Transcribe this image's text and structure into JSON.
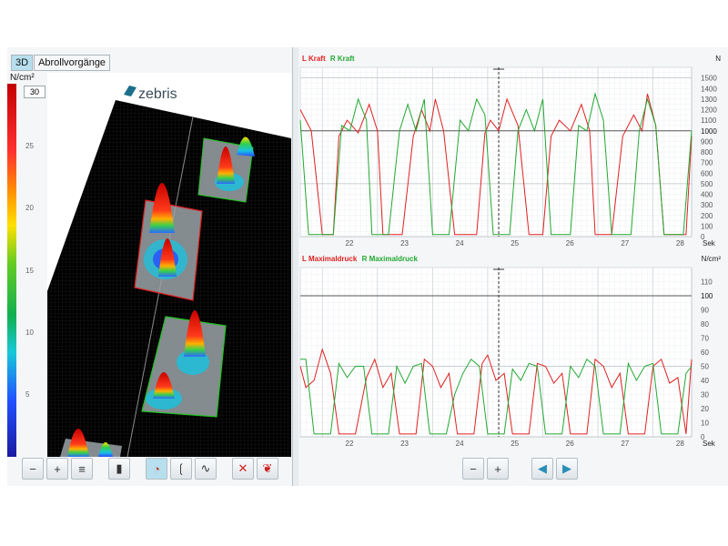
{
  "tabs": [
    {
      "label": "3D",
      "active": true
    },
    {
      "label": "Abrollvorgänge",
      "active": false
    }
  ],
  "pressure_scale": {
    "unit": "N/cm²",
    "box_value": "30",
    "ticks": [
      "25",
      "20",
      "15",
      "10",
      "5"
    ]
  },
  "scene": {
    "logo": "zebris"
  },
  "left_toolbar": {
    "icons": [
      "zoom-out-icon",
      "zoom-in-icon",
      "zoom-reset-icon",
      "view-mode-icon",
      "foot-view-icon",
      "left-foot-icon",
      "gait-line-icon",
      "clear-icon",
      "both-feet-icon"
    ]
  },
  "right_toolbar": {
    "icons": [
      "zoom-out-icon",
      "zoom-in-icon",
      "step-back-icon",
      "step-forward-icon"
    ]
  },
  "colors": {
    "left": "#e02020",
    "right": "#22a832",
    "background": "#f4f6f7"
  },
  "chart_data": [
    {
      "type": "line",
      "title": "",
      "legend": [
        {
          "label": "L Kraft",
          "color": "#e02020"
        },
        {
          "label": "R Kraft",
          "color": "#22a832"
        }
      ],
      "xlabel": "Sek",
      "ylabel": "N",
      "xlim": [
        21.1,
        28.2
      ],
      "ylim": [
        0,
        1600
      ],
      "xticks": [
        "22",
        "23",
        "24",
        "25",
        "26",
        "27",
        "28"
      ],
      "yticks": [
        "0",
        "100",
        "200",
        "300",
        "400",
        "500",
        "600",
        "700",
        "800",
        "900",
        "1000",
        "1100",
        "1200",
        "1300",
        "1400",
        "1500"
      ],
      "highlight_yticks": [
        "1000"
      ],
      "series": [
        {
          "name": "L Kraft",
          "x": [
            21.1,
            21.3,
            21.5,
            21.62,
            21.7,
            21.8,
            21.95,
            22.15,
            22.35,
            22.5,
            22.6,
            22.75,
            22.95,
            23.15,
            23.3,
            23.45,
            23.55,
            23.7,
            23.9,
            24.1,
            24.3,
            24.45,
            24.55,
            24.7,
            24.85,
            25.05,
            25.25,
            25.4,
            25.5,
            25.65,
            25.8,
            26.0,
            26.2,
            26.35,
            26.45,
            26.6,
            26.75,
            26.95,
            27.15,
            27.3,
            27.4,
            27.55,
            27.7,
            27.9,
            28.1,
            28.2
          ],
          "y": [
            1200,
            1000,
            20,
            20,
            20,
            950,
            1100,
            980,
            1250,
            1000,
            20,
            20,
            20,
            950,
            1200,
            1000,
            1300,
            1000,
            20,
            20,
            20,
            980,
            1100,
            1000,
            1300,
            1050,
            20,
            20,
            20,
            950,
            1100,
            1000,
            1250,
            1000,
            20,
            20,
            20,
            950,
            1150,
            1000,
            1350,
            1050,
            20,
            20,
            20,
            950
          ]
        },
        {
          "name": "R Kraft",
          "x": [
            21.1,
            21.25,
            21.4,
            21.55,
            21.7,
            21.85,
            22.0,
            22.15,
            22.3,
            22.4,
            22.55,
            22.7,
            22.9,
            23.05,
            23.2,
            23.35,
            23.5,
            23.65,
            23.8,
            24.0,
            24.15,
            24.3,
            24.45,
            24.6,
            24.75,
            24.9,
            25.05,
            25.2,
            25.35,
            25.5,
            25.65,
            25.8,
            26.0,
            26.15,
            26.3,
            26.45,
            26.6,
            26.75,
            26.95,
            27.1,
            27.25,
            27.4,
            27.55,
            27.7,
            27.9,
            28.05,
            28.2
          ],
          "y": [
            1100,
            20,
            20,
            20,
            20,
            1050,
            1000,
            1300,
            1100,
            20,
            20,
            20,
            1000,
            1250,
            1000,
            1300,
            20,
            20,
            20,
            1100,
            1000,
            1300,
            1150,
            20,
            20,
            20,
            1000,
            1200,
            1000,
            1300,
            20,
            20,
            20,
            1050,
            1000,
            1350,
            1100,
            20,
            20,
            20,
            1000,
            1300,
            1050,
            20,
            20,
            20,
            1000
          ]
        }
      ]
    },
    {
      "type": "line",
      "title": "",
      "legend": [
        {
          "label": "L Maximaldruck",
          "color": "#e02020"
        },
        {
          "label": "R Maximaldruck",
          "color": "#22a832"
        }
      ],
      "xlabel": "Sek",
      "ylabel": "N/cm²",
      "xlim": [
        21.1,
        28.2
      ],
      "ylim": [
        0,
        120
      ],
      "xticks": [
        "22",
        "23",
        "24",
        "25",
        "26",
        "27",
        "28"
      ],
      "yticks": [
        "0",
        "10",
        "20",
        "30",
        "40",
        "50",
        "60",
        "70",
        "80",
        "90",
        "100",
        "110"
      ],
      "highlight_yticks": [
        "100"
      ],
      "series": [
        {
          "name": "L Maximaldruck",
          "x": [
            21.1,
            21.2,
            21.35,
            21.5,
            21.65,
            21.8,
            21.95,
            22.1,
            22.3,
            22.45,
            22.6,
            22.75,
            22.9,
            23.05,
            23.2,
            23.35,
            23.5,
            23.65,
            23.8,
            23.95,
            24.1,
            24.25,
            24.4,
            24.5,
            24.65,
            24.8,
            24.95,
            25.1,
            25.25,
            25.4,
            25.55,
            25.7,
            25.85,
            26.0,
            26.15,
            26.3,
            26.45,
            26.6,
            26.75,
            26.9,
            27.05,
            27.2,
            27.35,
            27.5,
            27.65,
            27.8,
            27.95,
            28.1,
            28.2
          ],
          "y": [
            50,
            35,
            40,
            62,
            45,
            2,
            2,
            2,
            42,
            55,
            35,
            45,
            2,
            2,
            2,
            55,
            50,
            35,
            45,
            2,
            2,
            2,
            52,
            58,
            40,
            45,
            2,
            2,
            2,
            52,
            50,
            38,
            45,
            2,
            2,
            2,
            55,
            50,
            35,
            45,
            2,
            2,
            2,
            50,
            55,
            38,
            42,
            2,
            55
          ]
        },
        {
          "name": "R Maximaldruck",
          "x": [
            21.1,
            21.2,
            21.35,
            21.5,
            21.65,
            21.8,
            21.95,
            22.1,
            22.25,
            22.4,
            22.55,
            22.7,
            22.85,
            23.0,
            23.15,
            23.3,
            23.45,
            23.6,
            23.75,
            23.9,
            24.05,
            24.2,
            24.35,
            24.5,
            24.65,
            24.8,
            24.95,
            25.1,
            25.25,
            25.4,
            25.55,
            25.7,
            25.85,
            26.0,
            26.15,
            26.3,
            26.45,
            26.6,
            26.75,
            26.9,
            27.05,
            27.2,
            27.35,
            27.5,
            27.65,
            27.8,
            27.95,
            28.1,
            28.2
          ],
          "y": [
            55,
            55,
            2,
            2,
            2,
            52,
            42,
            50,
            50,
            2,
            2,
            2,
            50,
            38,
            50,
            52,
            2,
            2,
            2,
            30,
            45,
            55,
            50,
            2,
            2,
            2,
            48,
            40,
            52,
            50,
            2,
            2,
            2,
            50,
            42,
            55,
            50,
            2,
            2,
            2,
            52,
            40,
            50,
            52,
            2,
            2,
            2,
            45,
            50
          ]
        }
      ]
    }
  ]
}
